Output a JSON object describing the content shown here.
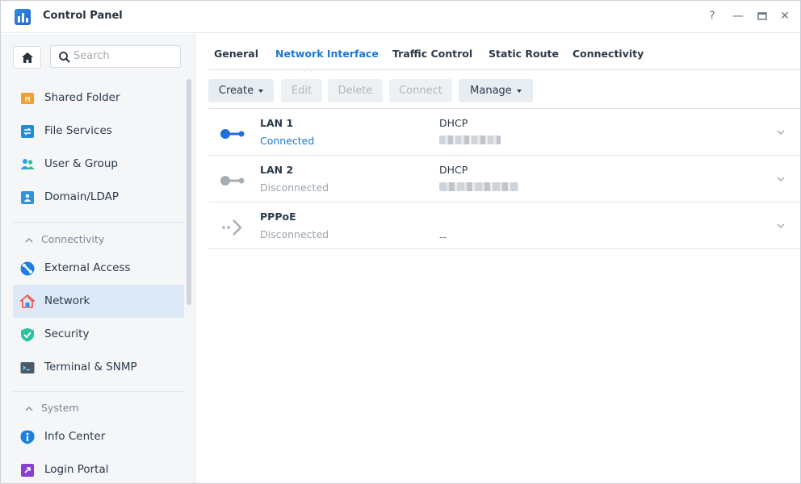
{
  "window": {
    "title": "Control Panel"
  },
  "controls": {
    "help": "?",
    "minimize": "—",
    "maximize": "□",
    "close": "✕"
  },
  "search": {
    "placeholder": "Search"
  },
  "sidebar": {
    "items": [
      {
        "label": "Shared Folder"
      },
      {
        "label": "File Services"
      },
      {
        "label": "User & Group"
      },
      {
        "label": "Domain/LDAP"
      },
      {
        "label": "External Access"
      },
      {
        "label": "Network"
      },
      {
        "label": "Security"
      },
      {
        "label": "Terminal & SNMP"
      },
      {
        "label": "Info Center"
      },
      {
        "label": "Login Portal"
      }
    ],
    "sections": [
      {
        "label": "Connectivity"
      },
      {
        "label": "System"
      }
    ]
  },
  "tabs": [
    {
      "label": "General"
    },
    {
      "label": "Network Interface"
    },
    {
      "label": "Traffic Control"
    },
    {
      "label": "Static Route"
    },
    {
      "label": "Connectivity"
    }
  ],
  "toolbar": {
    "create": "Create",
    "edit": "Edit",
    "delete": "Delete",
    "connect": "Connect",
    "manage": "Manage"
  },
  "interfaces": [
    {
      "name": "LAN 1",
      "status": "Connected",
      "mode": "DHCP",
      "ip": ""
    },
    {
      "name": "LAN 2",
      "status": "Disconnected",
      "mode": "DHCP",
      "ip": ""
    },
    {
      "name": "PPPoE",
      "status": "Disconnected",
      "mode": "",
      "ip": "--"
    }
  ],
  "colors": {
    "accent": "#1e78d2",
    "active_bg": "#dde9f6"
  }
}
